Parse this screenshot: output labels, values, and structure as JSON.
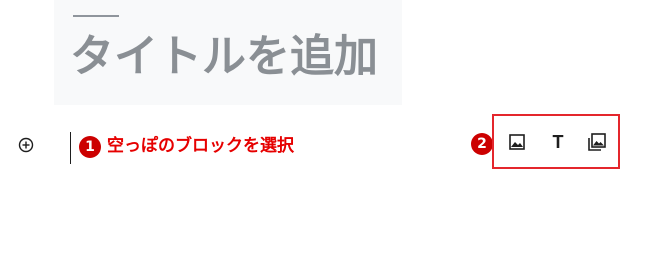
{
  "editor": {
    "post_title_placeholder": "タイトルを追加"
  },
  "annotations": {
    "badge_1": "1",
    "label_1": "空っぽのブロックを選択",
    "badge_2": "2"
  },
  "quick_inserter": {
    "buttons": [
      {
        "icon": "image-icon"
      },
      {
        "icon": "paragraph-icon",
        "glyph": "T"
      },
      {
        "icon": "gallery-icon"
      }
    ]
  },
  "colors": {
    "annotation_red": "#e60000",
    "badge_red": "#cc0000",
    "title_placeholder": "#8a8f94"
  }
}
